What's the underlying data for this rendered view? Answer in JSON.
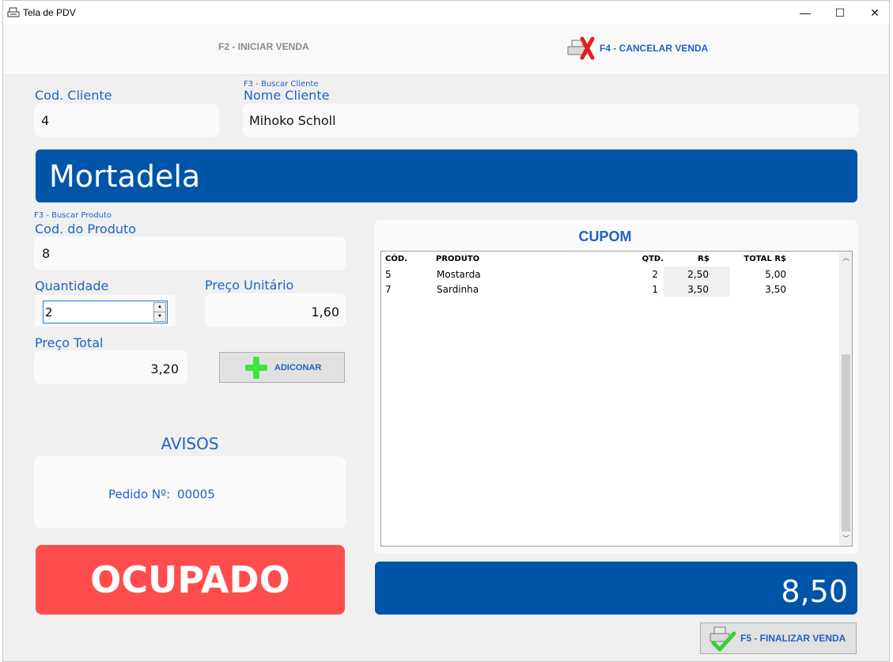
{
  "window": {
    "title": "Tela de PDV",
    "minimize": "—",
    "maximize": "☐",
    "close": "✕"
  },
  "toolbar": {
    "start_sale": "F2 - INICIAR VENDA",
    "cancel_sale": "F4 - CANCELAR VENDA"
  },
  "client": {
    "search_hint": "F3 - Buscar Cliente",
    "code_label": "Cod. Cliente",
    "code_value": "4",
    "name_label": "Nome Cliente",
    "name_value": "Mihoko Scholl"
  },
  "product_banner": "Mortadela",
  "product": {
    "search_hint": "F3 - Buscar Produto",
    "code_label": "Cod. do Produto",
    "code_value": "8",
    "qty_label": "Quantidade",
    "qty_value": "2",
    "unit_price_label": "Preço Unitário",
    "unit_price_value": "1,60",
    "total_label": "Preço Total",
    "total_value": "3,20",
    "add_button": "ADICONAR"
  },
  "notices": {
    "title": "AVISOS",
    "order_label": "Pedido Nº:",
    "order_number": "00005"
  },
  "status": "OCUPADO",
  "coupon": {
    "title": "CUPOM",
    "columns": [
      "CÓD.",
      "PRODUTO",
      "QTD.",
      "R$",
      "TOTAL R$"
    ],
    "rows": [
      [
        "5",
        "Mostarda",
        "2",
        "2,50",
        "5,00"
      ],
      [
        "7",
        "Sardinha",
        "1",
        "3,50",
        "3,50"
      ]
    ]
  },
  "grand_total": "8,50",
  "finalize_button": "F5 - FINALIZAR VENDA",
  "colors": {
    "accent_blue": "#0055a8",
    "label_blue": "#1e63c3",
    "busy_red": "#ff4c4c",
    "plus_green": "#3ee53e"
  }
}
